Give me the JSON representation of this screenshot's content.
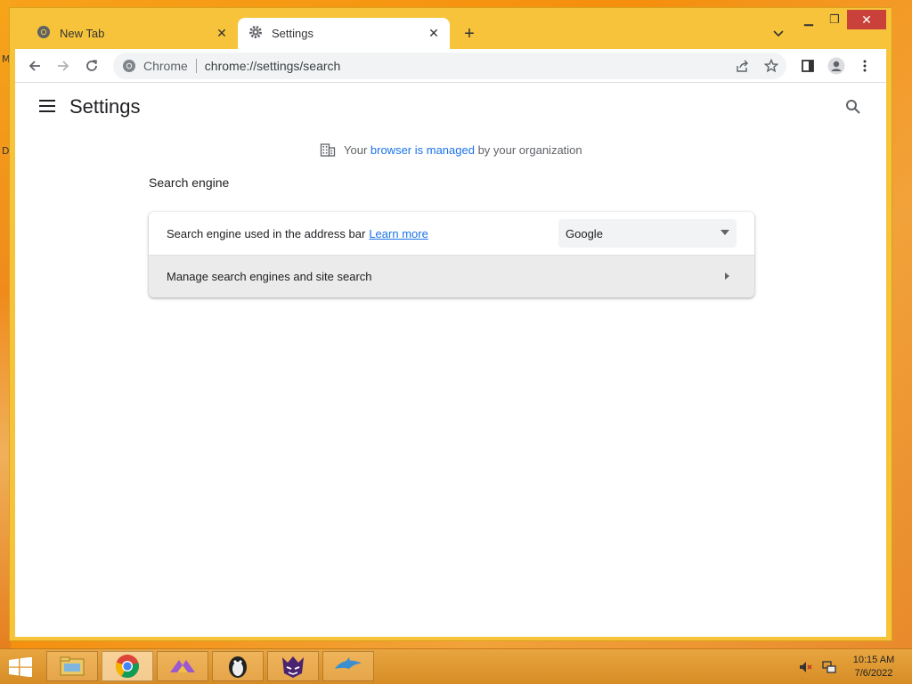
{
  "browser": {
    "tabs": [
      {
        "label": "New Tab",
        "icon": "chrome-icon",
        "active": false
      },
      {
        "label": "Settings",
        "icon": "gear-icon",
        "active": true
      }
    ],
    "window_buttons": {
      "minimize": "minimize-icon",
      "maximize": "maximize-icon",
      "close": "close-icon"
    },
    "omnibox": {
      "site_label": "Chrome",
      "url": "chrome://settings/search"
    }
  },
  "settings": {
    "page_title": "Settings",
    "managed_notice": {
      "prefix": "Your ",
      "link": "browser is managed",
      "suffix": " by your organization"
    },
    "section_title": "Search engine",
    "search_engine_row": {
      "label": "Search engine used in the address bar",
      "learn_more": "Learn more",
      "selected_engine": "Google"
    },
    "manage_row": {
      "label": "Manage search engines and site search"
    }
  },
  "taskbar": {
    "apps": [
      "file-explorer-icon",
      "chrome-icon",
      "app-triangle-icon",
      "app-penguin-icon",
      "app-cat-icon",
      "app-dolphin-icon"
    ],
    "clock": {
      "time": "10:15 AM",
      "date": "7/6/2022"
    }
  },
  "colors": {
    "accent_link": "#1a73e8",
    "frame": "#f6c33a",
    "close_button": "#c9413a"
  }
}
